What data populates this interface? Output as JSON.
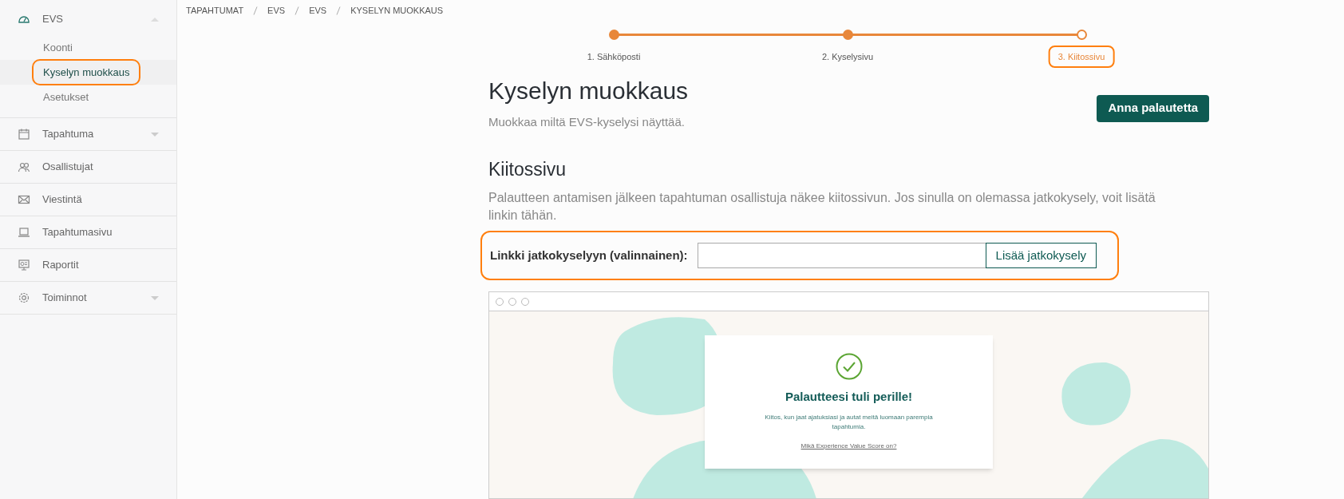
{
  "sidebar": {
    "items": [
      {
        "label": "EVS",
        "expanded": true,
        "children": [
          {
            "label": "Koonti",
            "selected": false,
            "highlighted": false
          },
          {
            "label": "Kyselyn muokkaus",
            "selected": true,
            "highlighted": true
          },
          {
            "label": "Asetukset",
            "selected": false,
            "highlighted": false
          }
        ]
      },
      {
        "label": "Tapahtuma",
        "expanded": false
      },
      {
        "label": "Osallistujat"
      },
      {
        "label": "Viestintä"
      },
      {
        "label": "Tapahtumasivu"
      },
      {
        "label": "Raportit"
      },
      {
        "label": "Toiminnot",
        "expanded": false
      }
    ]
  },
  "breadcrumb": [
    "TAPAHTUMAT",
    "EVS",
    "EVS",
    "KYSELYN MUOKKAUS"
  ],
  "stepper": [
    {
      "label": "1. Sähköposti",
      "done": true,
      "selected": false,
      "highlighted": false
    },
    {
      "label": "2. Kyselysivu",
      "done": true,
      "selected": false,
      "highlighted": false
    },
    {
      "label": "3. Kiitossivu",
      "done": false,
      "selected": true,
      "highlighted": true
    }
  ],
  "page": {
    "title": "Kyselyn muokkaus",
    "subtitle": "Muokkaa miltä EVS-kyselysi näyttää.",
    "feedback_button": "Anna palautetta"
  },
  "section": {
    "title": "Kiitossivu",
    "description": "Palautteen antamisen jälkeen tapahtuman osallistuja näkee kiitossivun. Jos sinulla on olemassa jatkokysely, voit lisätä linkin tähän.",
    "link_field": {
      "label": "Linkki jatkokyselyyn (valinnainen):",
      "button": "Lisää jatkokysely",
      "highlighted": true
    }
  },
  "preview": {
    "heading": "Palautteesi tuli perille!",
    "text": "Kiitos, kun jaat ajatuksiasi ja autat meitä luomaan parempia tapahtumia.",
    "link": "Mikä Experience Value Score on?"
  }
}
